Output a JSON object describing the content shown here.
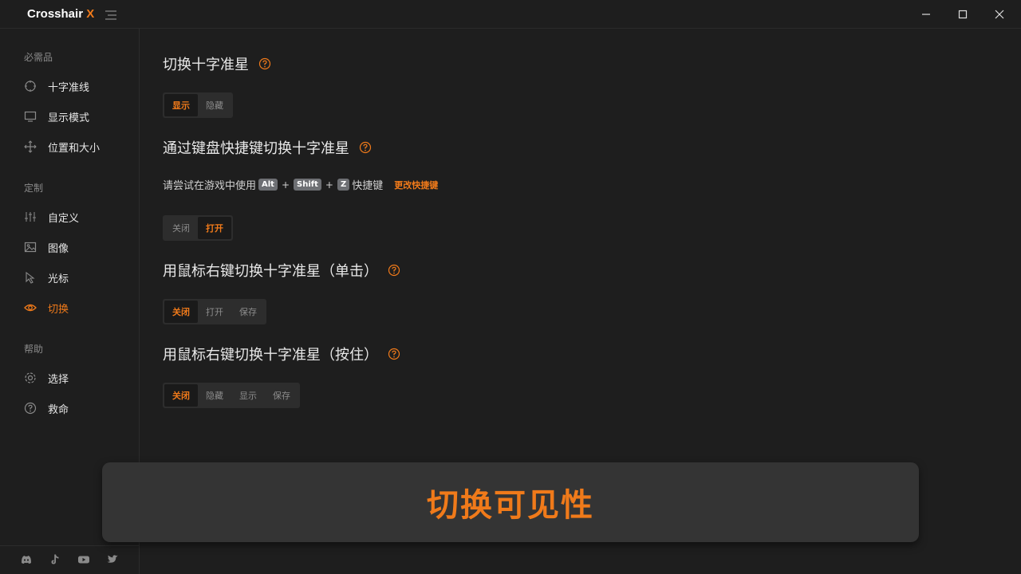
{
  "app": {
    "brand_name": "Crosshair",
    "brand_x": "X",
    "accent_color": "#f07a1a"
  },
  "window_controls": {
    "minimize_icon": "minimize-icon",
    "maximize_icon": "maximize-icon",
    "close_icon": "close-icon"
  },
  "sidebar": {
    "sections": [
      {
        "label": "必需品",
        "items": [
          {
            "label": "十字准线",
            "icon": "crosshair-icon"
          },
          {
            "label": "显示模式",
            "icon": "monitor-icon"
          },
          {
            "label": "位置和大小",
            "icon": "move-icon"
          }
        ]
      },
      {
        "label": "定制",
        "items": [
          {
            "label": "自定义",
            "icon": "sliders-icon"
          },
          {
            "label": "图像",
            "icon": "image-icon"
          },
          {
            "label": "光标",
            "icon": "cursor-icon"
          },
          {
            "label": "切换",
            "icon": "eye-icon",
            "active": true
          }
        ]
      },
      {
        "label": "帮助",
        "items": [
          {
            "label": "选择",
            "icon": "gear-icon"
          },
          {
            "label": "救命",
            "icon": "question-icon"
          }
        ]
      }
    ],
    "socials": [
      "discord-icon",
      "tiktok-icon",
      "youtube-icon",
      "twitter-icon"
    ]
  },
  "main": {
    "toggle_crosshair": {
      "title": "切换十字准星",
      "options": [
        "显示",
        "隐藏"
      ],
      "selected": "显示"
    },
    "keyboard_toggle": {
      "title": "通过键盘快捷键切换十字准星",
      "instruction_prefix": "请尝试在游戏中使用",
      "keys": [
        "Alt",
        "Shift",
        "Z"
      ],
      "instruction_suffix": "快捷键",
      "change_link": "更改快捷键",
      "options": [
        "关闭",
        "打开"
      ],
      "selected": "打开"
    },
    "right_click_single": {
      "title": "用鼠标右键切换十字准星（单击）",
      "options": [
        "关闭",
        "打开",
        "保存"
      ],
      "selected": "关闭"
    },
    "right_click_hold": {
      "title": "用鼠标右键切换十字准星（按住）",
      "options": [
        "关闭",
        "隐藏",
        "显示",
        "保存"
      ],
      "selected": "关闭"
    }
  },
  "banner": {
    "text": "切换可见性"
  }
}
